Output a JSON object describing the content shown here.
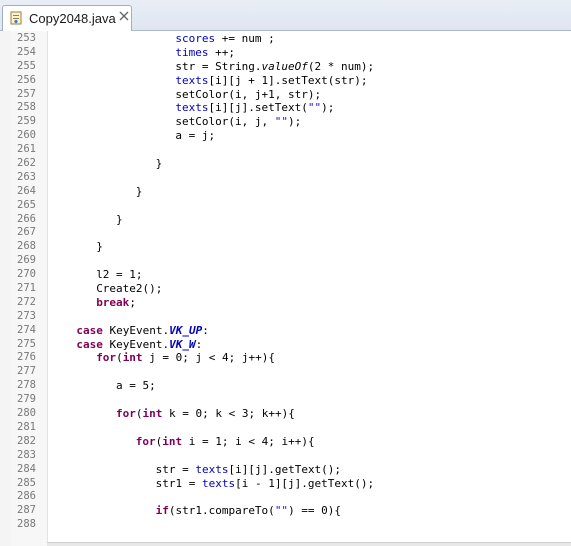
{
  "tab": {
    "title": "Copy2048.java",
    "icon": "java-file-icon",
    "close_icon": "close-icon"
  },
  "colors": {
    "keyword": "#7f0055",
    "field": "#0000c0",
    "string": "#2a00ff",
    "line_number": "#787878"
  },
  "lines": [
    {
      "n": "253",
      "indent": 19,
      "code": [
        [
          "f",
          "scores"
        ],
        [
          "p",
          " += num ;"
        ]
      ]
    },
    {
      "n": "254",
      "indent": 19,
      "code": [
        [
          "f",
          "times"
        ],
        [
          "p",
          " ++;"
        ]
      ]
    },
    {
      "n": "255",
      "indent": 19,
      "code": [
        [
          "p",
          "str = String."
        ],
        [
          "m",
          "valueOf"
        ],
        [
          "p",
          "(2 * num);"
        ]
      ]
    },
    {
      "n": "256",
      "indent": 19,
      "code": [
        [
          "f",
          "texts"
        ],
        [
          "p",
          "[i][j + 1].setText(str);"
        ]
      ]
    },
    {
      "n": "257",
      "indent": 19,
      "code": [
        [
          "p",
          "setColor(i, j+1, str);"
        ]
      ]
    },
    {
      "n": "258",
      "indent": 19,
      "code": [
        [
          "f",
          "texts"
        ],
        [
          "p",
          "[i][j].setText("
        ],
        [
          "s",
          "\"\""
        ],
        [
          "p",
          ");"
        ]
      ]
    },
    {
      "n": "259",
      "indent": 19,
      "code": [
        [
          "p",
          "setColor(i, j, "
        ],
        [
          "s",
          "\"\""
        ],
        [
          "p",
          ");"
        ]
      ]
    },
    {
      "n": "260",
      "indent": 19,
      "code": [
        [
          "p",
          "a = j;"
        ]
      ]
    },
    {
      "n": "261",
      "indent": 0,
      "code": []
    },
    {
      "n": "262",
      "indent": 16,
      "code": [
        [
          "p",
          "}"
        ]
      ]
    },
    {
      "n": "263",
      "indent": 0,
      "code": []
    },
    {
      "n": "264",
      "indent": 13,
      "code": [
        [
          "p",
          "}"
        ]
      ]
    },
    {
      "n": "265",
      "indent": 0,
      "code": []
    },
    {
      "n": "266",
      "indent": 10,
      "code": [
        [
          "p",
          "}"
        ]
      ]
    },
    {
      "n": "267",
      "indent": 0,
      "code": []
    },
    {
      "n": "268",
      "indent": 7,
      "code": [
        [
          "p",
          "}"
        ]
      ]
    },
    {
      "n": "269",
      "indent": 0,
      "code": []
    },
    {
      "n": "270",
      "indent": 7,
      "code": [
        [
          "p",
          "l2 = 1;"
        ]
      ]
    },
    {
      "n": "271",
      "indent": 7,
      "code": [
        [
          "p",
          "Create2();"
        ]
      ]
    },
    {
      "n": "272",
      "indent": 7,
      "code": [
        [
          "k",
          "break"
        ],
        [
          "p",
          ";"
        ]
      ]
    },
    {
      "n": "273",
      "indent": 0,
      "code": []
    },
    {
      "n": "274",
      "indent": 4,
      "code": [
        [
          "k",
          "case"
        ],
        [
          "p",
          " KeyEvent."
        ],
        [
          "c",
          "VK_UP"
        ],
        [
          "p",
          ":"
        ]
      ]
    },
    {
      "n": "275",
      "indent": 4,
      "code": [
        [
          "k",
          "case"
        ],
        [
          "p",
          " KeyEvent."
        ],
        [
          "c",
          "VK_W"
        ],
        [
          "p",
          ":"
        ]
      ]
    },
    {
      "n": "276",
      "indent": 7,
      "code": [
        [
          "k",
          "for"
        ],
        [
          "p",
          "("
        ],
        [
          "k",
          "int"
        ],
        [
          "p",
          " j = 0; j < 4; j++){"
        ]
      ]
    },
    {
      "n": "277",
      "indent": 0,
      "code": []
    },
    {
      "n": "278",
      "indent": 10,
      "code": [
        [
          "p",
          "a = 5;"
        ]
      ]
    },
    {
      "n": "279",
      "indent": 0,
      "code": []
    },
    {
      "n": "280",
      "indent": 10,
      "code": [
        [
          "k",
          "for"
        ],
        [
          "p",
          "("
        ],
        [
          "k",
          "int"
        ],
        [
          "p",
          " k = 0; k < 3; k++){"
        ]
      ]
    },
    {
      "n": "281",
      "indent": 0,
      "code": []
    },
    {
      "n": "282",
      "indent": 13,
      "code": [
        [
          "k",
          "for"
        ],
        [
          "p",
          "("
        ],
        [
          "k",
          "int"
        ],
        [
          "p",
          " i = 1; i < 4; i++){"
        ]
      ]
    },
    {
      "n": "283",
      "indent": 0,
      "code": []
    },
    {
      "n": "284",
      "indent": 16,
      "code": [
        [
          "p",
          "str = "
        ],
        [
          "f",
          "texts"
        ],
        [
          "p",
          "[i][j].getText();"
        ]
      ]
    },
    {
      "n": "285",
      "indent": 16,
      "code": [
        [
          "p",
          "str1 = "
        ],
        [
          "f",
          "texts"
        ],
        [
          "p",
          "[i - 1][j].getText();"
        ]
      ]
    },
    {
      "n": "286",
      "indent": 0,
      "code": []
    },
    {
      "n": "287",
      "indent": 16,
      "code": [
        [
          "k",
          "if"
        ],
        [
          "p",
          "(str1.compareTo("
        ],
        [
          "s",
          "\"\""
        ],
        [
          "p",
          ") == 0){"
        ]
      ]
    },
    {
      "n": "288",
      "indent": 0,
      "code": []
    }
  ]
}
